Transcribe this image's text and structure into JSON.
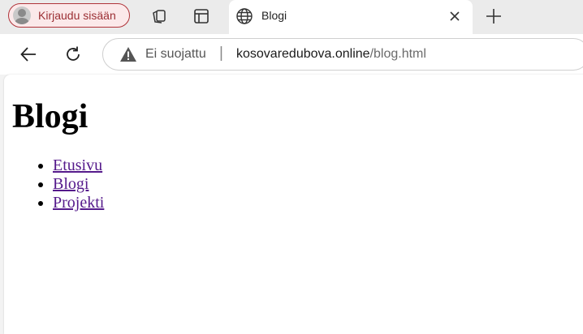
{
  "browser": {
    "profile_label": "Kirjaudu sisään",
    "active_tab_title": "Blogi",
    "security_status": "Ei suojattu",
    "url_separator": "|",
    "url_host": "kosovaredubova.online",
    "url_path": "/blog.html",
    "icons": [
      "avatar-icon",
      "collections-icon",
      "tab-actions-icon",
      "globe-icon",
      "close-icon",
      "plus-icon",
      "back-icon",
      "reload-icon",
      "warning-icon"
    ],
    "colors": {
      "profile_accent": "#b0343a",
      "link_visited": "#551a8b"
    }
  },
  "page": {
    "heading": "Blogi",
    "nav": [
      {
        "label": "Etusivu"
      },
      {
        "label": "Blogi"
      },
      {
        "label": "Projekti"
      }
    ]
  }
}
